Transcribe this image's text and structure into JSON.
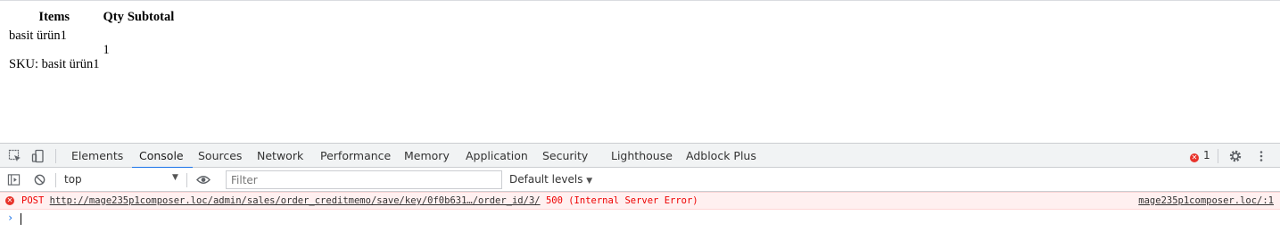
{
  "order_items": {
    "headers": {
      "items": "Items",
      "qty": "Qty",
      "subtotal": "Subtotal"
    },
    "rows": [
      {
        "name": "basit ürün1",
        "sku_label": "SKU: basit ürün1",
        "qty": "1"
      }
    ]
  },
  "devtools": {
    "tabs": [
      "Elements",
      "Console",
      "Sources",
      "Network",
      "Performance",
      "Memory",
      "Application",
      "Security",
      "Lighthouse",
      "Adblock Plus"
    ],
    "active_tab": "Console",
    "error_count": "1",
    "console_toolbar": {
      "context": "top",
      "filter_placeholder": "Filter",
      "levels": "Default levels"
    },
    "messages": [
      {
        "level": "error",
        "method": "POST",
        "url": "http://mage235p1composer.loc/admin/sales/order_creditmemo/save/key/0f0b631…/order_id/3/",
        "status": "500 (Internal Server Error)",
        "source": "mage235p1composer.loc/:1"
      }
    ],
    "colors": {
      "accent": "#1a73e8",
      "error": "#e8332b",
      "error_bg": "#fff0f0"
    }
  }
}
